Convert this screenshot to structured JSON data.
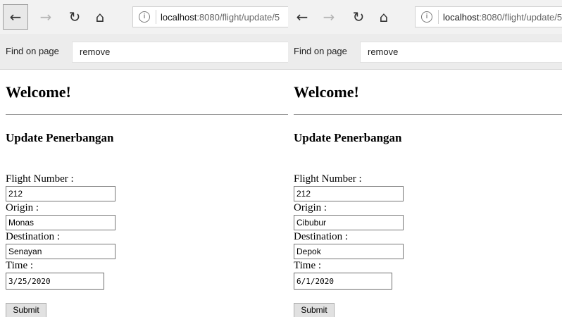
{
  "panels": [
    {
      "browser": {
        "url_host": "localhost",
        "url_path": ":8080/flight/update/5",
        "info_icon": "info-icon"
      },
      "find_bar": {
        "label": "Find on page",
        "value": "remove"
      },
      "page": {
        "heading": "Welcome!",
        "subtitle": "Update Penerbangan",
        "form": {
          "flight_number_label": "Flight Number :",
          "flight_number_value": "212",
          "origin_label": "Origin :",
          "origin_value": "Monas",
          "destination_label": "Destination :",
          "destination_value": "Senayan",
          "time_label": "Time :",
          "time_value": "3/25/2020",
          "submit_label": "Submit"
        }
      }
    },
    {
      "browser": {
        "url_host": "localhost",
        "url_path": ":8080/flight/update/5",
        "info_icon": "info-icon"
      },
      "find_bar": {
        "label": "Find on page",
        "value": "remove"
      },
      "page": {
        "heading": "Welcome!",
        "subtitle": "Update Penerbangan",
        "form": {
          "flight_number_label": "Flight Number :",
          "flight_number_value": "212",
          "origin_label": "Origin :",
          "origin_value": "Cibubur",
          "destination_label": "Destination :",
          "destination_value": "Depok",
          "time_label": "Time :",
          "time_value": "6/1/2020",
          "submit_label": "Submit"
        }
      }
    }
  ]
}
